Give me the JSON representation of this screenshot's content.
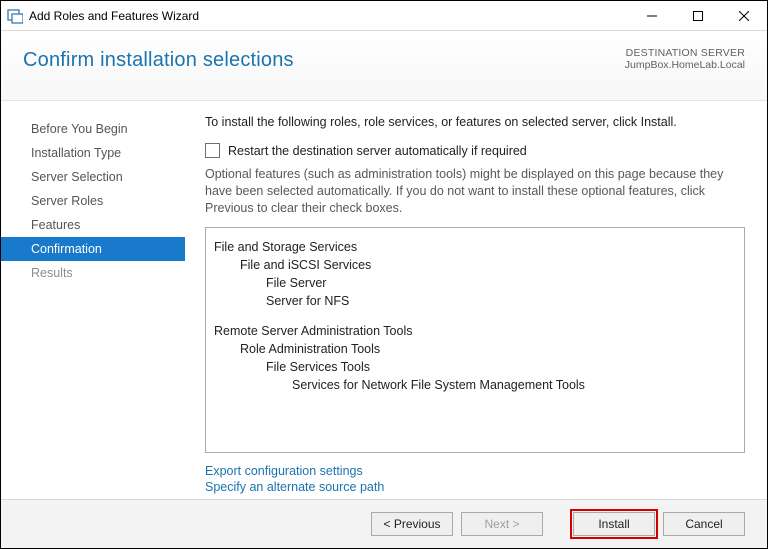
{
  "window": {
    "title": "Add Roles and Features Wizard"
  },
  "header": {
    "title": "Confirm installation selections",
    "dest_label": "DESTINATION SERVER",
    "dest_value": "JumpBox.HomeLab.Local"
  },
  "sidebar": {
    "items": [
      {
        "label": "Before You Begin",
        "enabled": true,
        "active": false
      },
      {
        "label": "Installation Type",
        "enabled": true,
        "active": false
      },
      {
        "label": "Server Selection",
        "enabled": true,
        "active": false
      },
      {
        "label": "Server Roles",
        "enabled": true,
        "active": false
      },
      {
        "label": "Features",
        "enabled": true,
        "active": false
      },
      {
        "label": "Confirmation",
        "enabled": true,
        "active": true
      },
      {
        "label": "Results",
        "enabled": false,
        "active": false
      }
    ]
  },
  "content": {
    "intro": "To install the following roles, role services, or features on selected server, click Install.",
    "restart_label": "Restart the destination server automatically if required",
    "restart_checked": false,
    "note": "Optional features (such as administration tools) might be displayed on this page because they have been selected automatically. If you do not want to install these optional features, click Previous to clear their check boxes.",
    "selections": [
      [
        {
          "indent": 0,
          "text": "File and Storage Services"
        },
        {
          "indent": 1,
          "text": "File and iSCSI Services"
        },
        {
          "indent": 2,
          "text": "File Server"
        },
        {
          "indent": 2,
          "text": "Server for NFS"
        }
      ],
      [
        {
          "indent": 0,
          "text": "Remote Server Administration Tools"
        },
        {
          "indent": 1,
          "text": "Role Administration Tools"
        },
        {
          "indent": 2,
          "text": "File Services Tools"
        },
        {
          "indent": 3,
          "text": "Services for Network File System Management Tools"
        }
      ]
    ],
    "links": {
      "export": "Export configuration settings",
      "alt_source": "Specify an alternate source path"
    }
  },
  "footer": {
    "previous": "< Previous",
    "next": "Next >",
    "install": "Install",
    "cancel": "Cancel"
  }
}
